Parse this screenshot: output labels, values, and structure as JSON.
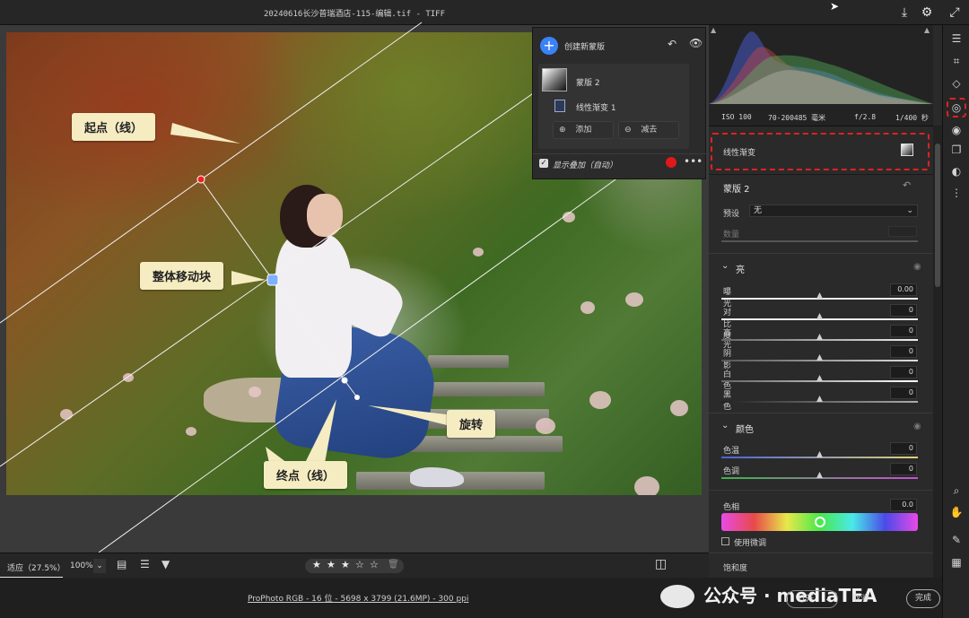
{
  "window": {
    "title": "20240616长沙普瑞酒店-115-编辑.tif  -  TIFF"
  },
  "photo": {
    "callouts": {
      "start": "起点（线）",
      "move": "整体移动块",
      "rotate": "旋转",
      "end": "终点（线）"
    }
  },
  "masks": {
    "create_label": "创建新蒙版",
    "mask_name": "蒙版 2",
    "component_name": "线性渐变 1",
    "add_label": "添加",
    "subtract_label": "减去",
    "overlay_label": "显示叠加（自动）",
    "overlay_color": "#e0181b"
  },
  "bottom": {
    "fit_label": "适应（27.5%）",
    "zoom_label": "100%",
    "stars": [
      "★",
      "★",
      "★",
      "☆",
      "☆"
    ],
    "file_info": "ProPhoto RGB - 16 位 - 5698 x 3799 (21.6MP) - 300 ppi",
    "open_label": "打开",
    "cancel_label": "取消",
    "done_label": "完成"
  },
  "watermark": {
    "text": "公众号 · mediaTEA"
  },
  "histogram": {
    "iso": "ISO 100",
    "lens": "70-200485 毫米",
    "aperture": "f/2.8",
    "shutter": "1/400 秒"
  },
  "panel": {
    "mask_type": "线性渐变",
    "mask_title": "蒙版 2",
    "preset_label": "预设",
    "preset_value": "无",
    "amount_label": "数量",
    "light": {
      "title": "亮",
      "sliders": [
        {
          "label": "曝光",
          "value": "0.00"
        },
        {
          "label": "对比度",
          "value": "0"
        },
        {
          "label": "高光",
          "value": "0"
        },
        {
          "label": "阴影",
          "value": "0"
        },
        {
          "label": "白色",
          "value": "0"
        },
        {
          "label": "黑色",
          "value": "0"
        }
      ]
    },
    "color": {
      "title": "颜色",
      "temp_label": "色温",
      "temp_value": "0",
      "tint_label": "色调",
      "tint_value": "0",
      "hue_label": "色相",
      "hue_value": "0.0",
      "fine_label": "使用微调",
      "sat_label": "饱和度"
    }
  }
}
